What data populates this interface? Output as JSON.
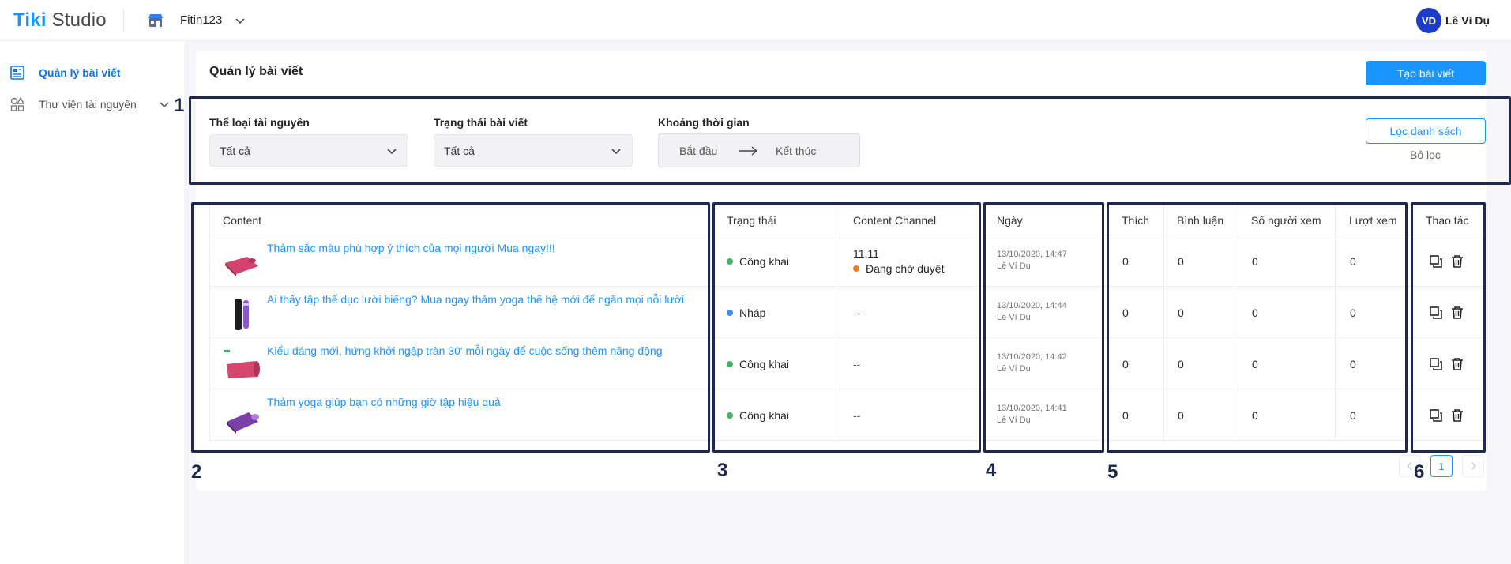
{
  "header": {
    "logo_tiki": "Tiki",
    "logo_studio": "Studio",
    "shop_name": "Fitin123",
    "avatar_initials": "VD",
    "user_name": "Lê Ví Dụ"
  },
  "sidebar": {
    "items": [
      {
        "label": "Quản lý bài viết",
        "icon": "article-icon",
        "active": true
      },
      {
        "label": "Thư viện tài nguyên",
        "icon": "shapes-icon",
        "active": false
      }
    ]
  },
  "page": {
    "title": "Quản lý bài viết",
    "create_button": "Tạo bài viết"
  },
  "filters": {
    "resource_type_label": "Thể loại tài nguyên",
    "resource_type_value": "Tất cả",
    "post_status_label": "Trạng thái bài viết",
    "post_status_value": "Tất cả",
    "time_range_label": "Khoảng thời gian",
    "start_placeholder": "Bắt đầu",
    "end_placeholder": "Kết thúc",
    "filter_button": "Lọc danh sách",
    "clear_button": "Bỏ lọc"
  },
  "table": {
    "columns": {
      "content": "Content",
      "status": "Trạng thái",
      "channel": "Content Channel",
      "date": "Ngày",
      "likes": "Thích",
      "comments": "Bình luận",
      "viewers": "Số người xem",
      "views": "Lượt xem",
      "actions": "Thao tác"
    },
    "rows": [
      {
        "title": "Thảm sắc màu phù hợp ý thích của mọi người Mua ngay!!!",
        "status": "Công khai",
        "status_color": "#3eb55f",
        "channel_name": "11.11",
        "channel_state": "Đang chờ duyệt",
        "channel_state_color": "#f27c22",
        "channel": "",
        "date": "13/10/2020, 14:47",
        "author": "Lê Ví Dụ",
        "likes": "0",
        "comments": "0",
        "viewers": "0",
        "views": "0"
      },
      {
        "title": "Ai thấy tập thể dục lười biếng? Mua ngay thảm yoga thế hệ mới để ngăn mọi nỗi lười",
        "status": "Nháp",
        "status_color": "#3b8ef5",
        "channel_name": "",
        "channel_state": "",
        "channel": "--",
        "date": "13/10/2020, 14:44",
        "author": "Lê Ví Dụ",
        "likes": "0",
        "comments": "0",
        "viewers": "0",
        "views": "0"
      },
      {
        "title": "Kiểu dáng mới, hứng khởi ngập tràn 30' mỗi ngày để cuộc sống thêm năng động",
        "status": "Công khai",
        "status_color": "#3eb55f",
        "channel_name": "",
        "channel_state": "",
        "channel": "--",
        "date": "13/10/2020, 14:42",
        "author": "Lê Ví Dụ",
        "likes": "0",
        "comments": "0",
        "viewers": "0",
        "views": "0"
      },
      {
        "title": "Thảm yoga giúp bạn có những giờ tập hiệu quả",
        "status": "Công khai",
        "status_color": "#3eb55f",
        "channel_name": "",
        "channel_state": "",
        "channel": "--",
        "date": "13/10/2020, 14:41",
        "author": "Lê Ví Dụ",
        "likes": "0",
        "comments": "0",
        "viewers": "0",
        "views": "0"
      }
    ]
  },
  "pagination": {
    "current": "1"
  },
  "annotations": [
    "1",
    "2",
    "3",
    "4",
    "5",
    "6"
  ],
  "colors": {
    "accent": "#1a94ff",
    "annotation": "#1e2a4d",
    "public": "#3eb55f",
    "draft": "#3b8ef5",
    "pending": "#f27c22"
  }
}
